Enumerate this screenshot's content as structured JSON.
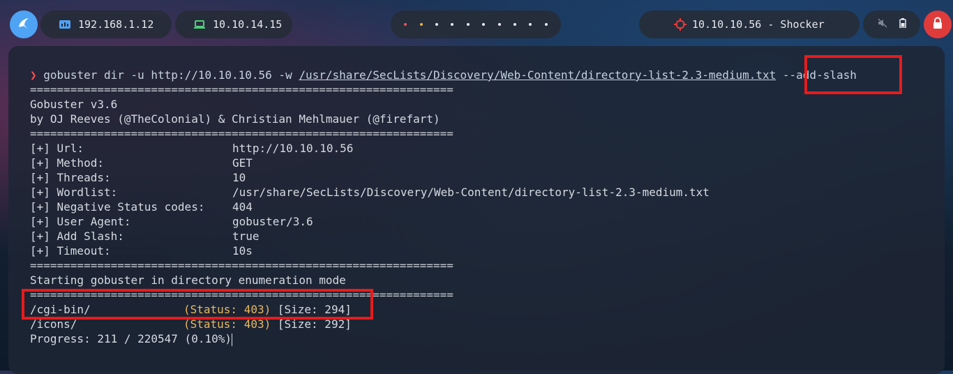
{
  "topbar": {
    "ip_local": "192.168.1.12",
    "ip_vpn": "10.10.14.15",
    "target_label": "10.10.10.56 - Shocker",
    "workspace_count": 10,
    "colors": {
      "logo": "#4fa3f5",
      "lock": "#e03b3b",
      "vpn_icon": "#4fcf7a",
      "local_icon": "#4fa3f5",
      "target_icon": "#e53b3b"
    }
  },
  "terminal": {
    "prompt_symbol": "❯",
    "cmd_prefix": "gobuster dir -u http://10.10.10.56 -w ",
    "cmd_wordlist": "/usr/share/SecLists/Discovery/Web-Content/directory-list-2.3-medium.txt",
    "cmd_flag": " --add-slash",
    "separator": "===============================================================",
    "banner_title": "Gobuster v3.6",
    "banner_author": "by OJ Reeves (@TheColonial) & Christian Mehlmauer (@firefart)",
    "settings": [
      {
        "key": "[+] Url:",
        "value": "http://10.10.10.56"
      },
      {
        "key": "[+] Method:",
        "value": "GET"
      },
      {
        "key": "[+] Threads:",
        "value": "10"
      },
      {
        "key": "[+] Wordlist:",
        "value": "/usr/share/SecLists/Discovery/Web-Content/directory-list-2.3-medium.txt"
      },
      {
        "key": "[+] Negative Status codes:",
        "value": "404"
      },
      {
        "key": "[+] User Agent:",
        "value": "gobuster/3.6"
      },
      {
        "key": "[+] Add Slash:",
        "value": "true"
      },
      {
        "key": "[+] Timeout:",
        "value": "10s"
      }
    ],
    "start_msg": "Starting gobuster in directory enumeration mode",
    "results": [
      {
        "path": "/cgi-bin/",
        "status": "(Status: 403)",
        "size": "[Size: 294]"
      },
      {
        "path": "/icons/",
        "status": "(Status: 403)",
        "size": "[Size: 292]"
      }
    ],
    "progress": "Progress: 211 / 220547 (0.10%)"
  }
}
